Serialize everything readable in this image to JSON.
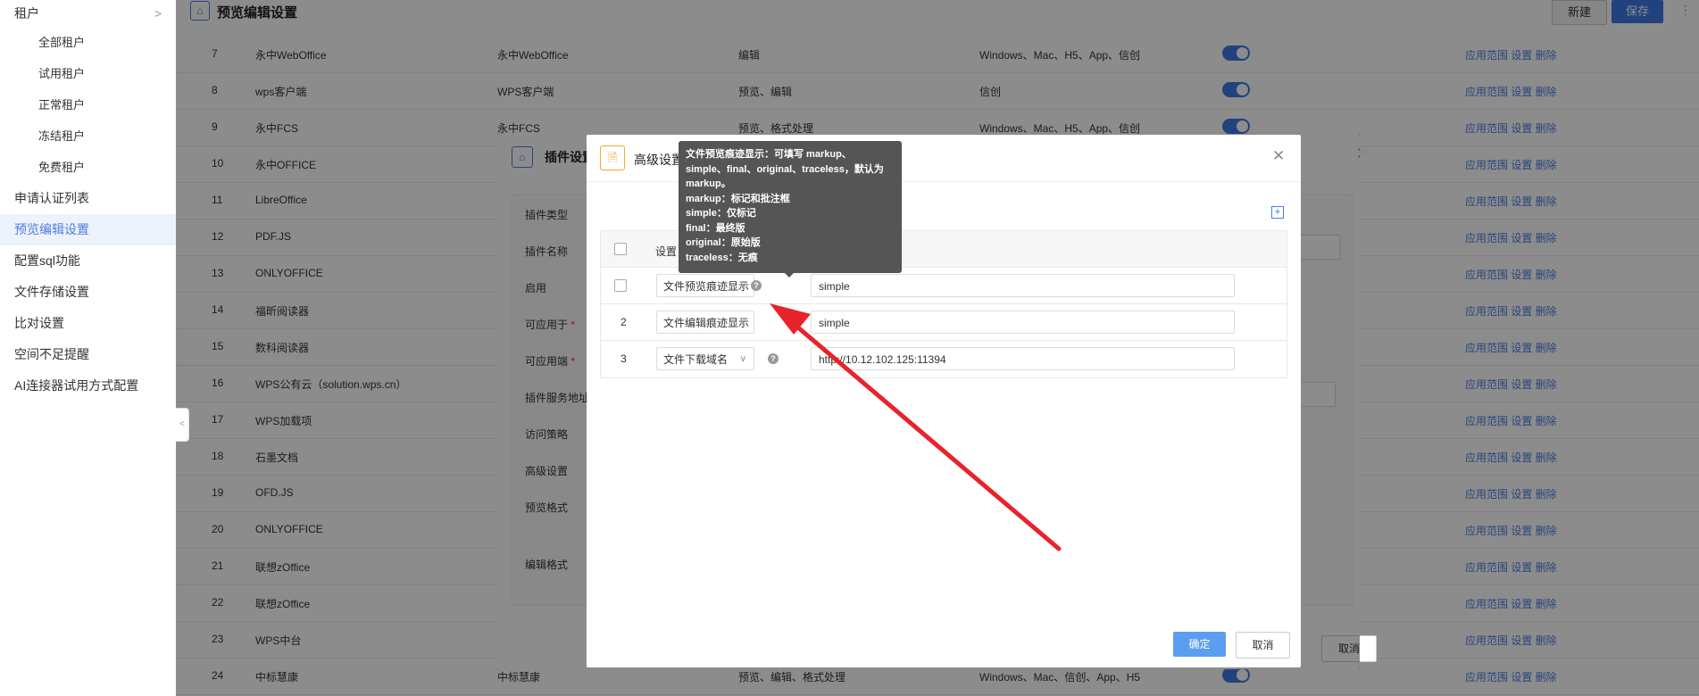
{
  "sidebar": {
    "group_label": "租户",
    "sub_items": [
      "全部租户",
      "试用租户",
      "正常租户",
      "冻结租户",
      "免费租户"
    ],
    "items": [
      "申请认证列表",
      "预览编辑设置",
      "配置sql功能",
      "文件存储设置",
      "比对设置",
      "空间不足提醒",
      "AI连接器试用方式配置"
    ],
    "active_index": 1
  },
  "header": {
    "title": "预览编辑设置",
    "new_label": "新建",
    "save_label": "保存"
  },
  "table": {
    "rows": [
      {
        "no": "7",
        "name": "永中WebOffice",
        "type": "永中WebOffice",
        "func": "编辑",
        "platform": "Windows、Mac、H5、App、信创",
        "toggle": true,
        "actions": "应用范围  设置  删除"
      },
      {
        "no": "8",
        "name": "wps客户端",
        "type": "WPS客户端",
        "func": "预览、编辑",
        "platform": "信创",
        "toggle": true,
        "actions": "应用范围  设置  删除"
      },
      {
        "no": "9",
        "name": "永中FCS",
        "type": "永中FCS",
        "func": "预览、格式处理",
        "platform": "Windows、Mac、H5、App、信创",
        "toggle": true,
        "actions": "应用范围  设置  删除"
      },
      {
        "no": "10",
        "name": "永中OFFICE",
        "type": "",
        "func": "",
        "platform": "",
        "toggle": false,
        "actions": "应用范围  设置  删除"
      },
      {
        "no": "11",
        "name": "LibreOffice",
        "type": "",
        "func": "",
        "platform": "",
        "toggle": false,
        "actions": "应用范围  设置  删除"
      },
      {
        "no": "12",
        "name": "PDF.JS",
        "type": "",
        "func": "",
        "platform": "",
        "toggle": false,
        "actions": "应用范围  设置  删除"
      },
      {
        "no": "13",
        "name": "ONLYOFFICE",
        "type": "",
        "func": "",
        "platform": "",
        "toggle": false,
        "actions": "应用范围  设置  删除"
      },
      {
        "no": "14",
        "name": "福昕阅读器",
        "type": "",
        "func": "",
        "platform": "",
        "toggle": false,
        "actions": "应用范围  设置  删除"
      },
      {
        "no": "15",
        "name": "数科阅读器",
        "type": "",
        "func": "",
        "platform": "",
        "toggle": false,
        "actions": "应用范围  设置  删除"
      },
      {
        "no": "16",
        "name": "WPS公有云（solution.wps.cn）",
        "type": "",
        "func": "",
        "platform": "",
        "toggle": false,
        "actions": "应用范围  设置  删除"
      },
      {
        "no": "17",
        "name": "WPS加载项",
        "type": "",
        "func": "",
        "platform": "",
        "toggle": false,
        "actions": "应用范围  设置  删除"
      },
      {
        "no": "18",
        "name": "石墨文档",
        "type": "",
        "func": "",
        "platform": "",
        "toggle": false,
        "actions": "应用范围  设置  删除"
      },
      {
        "no": "19",
        "name": "OFD.JS",
        "type": "",
        "func": "",
        "platform": "",
        "toggle": false,
        "actions": "应用范围  设置  删除"
      },
      {
        "no": "20",
        "name": "ONLYOFFICE",
        "type": "",
        "func": "",
        "platform": "",
        "toggle": false,
        "actions": "应用范围  设置  删除"
      },
      {
        "no": "21",
        "name": "联想zOffice",
        "type": "",
        "func": "",
        "platform": "",
        "toggle": false,
        "actions": "应用范围  设置  删除"
      },
      {
        "no": "22",
        "name": "联想zOffice",
        "type": "",
        "func": "",
        "platform": "",
        "toggle": false,
        "actions": "应用范围  设置  删除"
      },
      {
        "no": "23",
        "name": "WPS中台",
        "type": "",
        "func": "",
        "platform": "",
        "toggle": false,
        "actions": "应用范围  设置  删除"
      },
      {
        "no": "24",
        "name": "中标慧康",
        "type": "中标慧康",
        "func": "预览、编辑、格式处理",
        "platform": "Windows、Mac、信创、App、H5",
        "toggle": true,
        "actions": "应用范围  设置  删除"
      }
    ]
  },
  "plugin_dialog": {
    "title": "插件设置",
    "form_labels": [
      "插件类型",
      "插件名称",
      "启用",
      "可应用于",
      "可应用端",
      "插件服务地址",
      "访问策略",
      "高级设置",
      "预览格式",
      "编辑格式"
    ],
    "required_labels": [
      "可应用于",
      "可应用端"
    ],
    "cancel_label": "取消"
  },
  "advanced_dialog": {
    "title": "高级设置",
    "header_label": "设置",
    "rows": [
      {
        "index": "",
        "setting": "文件预览痕迹显示",
        "value": "simple"
      },
      {
        "index": "2",
        "setting": "文件编辑痕迹显示",
        "value": "simple"
      },
      {
        "index": "3",
        "setting": "文件下载域名",
        "value": "http://10.12.102.125:11394"
      }
    ],
    "ok_label": "确定",
    "cancel_label": "取消"
  },
  "tooltip": {
    "lines": [
      "文件预览痕迹显示：可填写 markup、",
      "simple、final、original、traceless，默认为",
      "markup。",
      "markup：标记和批注框",
      "simple：仅标记",
      "final：最终版",
      "original：原始版",
      "traceless：无痕"
    ]
  },
  "colors": {
    "accent": "#3e78e4",
    "link": "#4a7fe0",
    "annotation_arrow": "#e8232b"
  },
  "icons": {
    "page": "home-icon",
    "plugin": "home-icon",
    "advanced": "document-icon",
    "close": "close-icon",
    "add": "plus-icon",
    "help": "question-icon"
  }
}
